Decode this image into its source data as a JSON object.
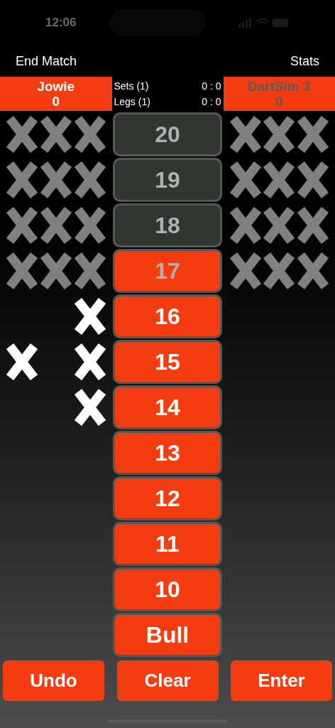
{
  "status_bar": {
    "time": "12:06"
  },
  "nav": {
    "left": "End Match",
    "right": "Stats"
  },
  "players": [
    {
      "name": "Jowie",
      "score": "0",
      "active": true
    },
    {
      "name": "DartSim 3",
      "score": "0",
      "active": false
    }
  ],
  "match": [
    {
      "label": "Sets (1)",
      "value": "0 : 0"
    },
    {
      "label": "Legs (1)",
      "value": "0 : 0"
    }
  ],
  "rows": [
    {
      "label": "20",
      "disabled": true,
      "closed": true,
      "left": [
        true,
        true,
        true
      ],
      "right": [
        true,
        true,
        true
      ]
    },
    {
      "label": "19",
      "disabled": true,
      "closed": true,
      "left": [
        true,
        true,
        true
      ],
      "right": [
        true,
        true,
        true
      ]
    },
    {
      "label": "18",
      "disabled": true,
      "closed": true,
      "left": [
        true,
        true,
        true
      ],
      "right": [
        true,
        true,
        true
      ]
    },
    {
      "label": "17",
      "disabled": false,
      "closed": true,
      "left": [
        true,
        true,
        true
      ],
      "right": [
        true,
        true,
        true
      ]
    },
    {
      "label": "16",
      "disabled": false,
      "closed": false,
      "left": [
        false,
        false,
        true
      ],
      "right": [
        false,
        false,
        false
      ]
    },
    {
      "label": "15",
      "disabled": false,
      "closed": false,
      "left": [
        true,
        false,
        true
      ],
      "right": [
        false,
        false,
        false
      ]
    },
    {
      "label": "14",
      "disabled": false,
      "closed": false,
      "left": [
        false,
        false,
        true
      ],
      "right": [
        false,
        false,
        false
      ]
    },
    {
      "label": "13",
      "disabled": false,
      "closed": false,
      "left": [
        false,
        false,
        false
      ],
      "right": [
        false,
        false,
        false
      ]
    },
    {
      "label": "12",
      "disabled": false,
      "closed": false,
      "left": [
        false,
        false,
        false
      ],
      "right": [
        false,
        false,
        false
      ]
    },
    {
      "label": "11",
      "disabled": false,
      "closed": false,
      "left": [
        false,
        false,
        false
      ],
      "right": [
        false,
        false,
        false
      ]
    },
    {
      "label": "10",
      "disabled": false,
      "closed": false,
      "left": [
        false,
        false,
        false
      ],
      "right": [
        false,
        false,
        false
      ]
    },
    {
      "label": "Bull",
      "disabled": false,
      "closed": false,
      "left": [
        false,
        false,
        false
      ],
      "right": [
        false,
        false,
        false
      ]
    }
  ],
  "actions": [
    "Undo",
    "Clear",
    "Enter"
  ]
}
